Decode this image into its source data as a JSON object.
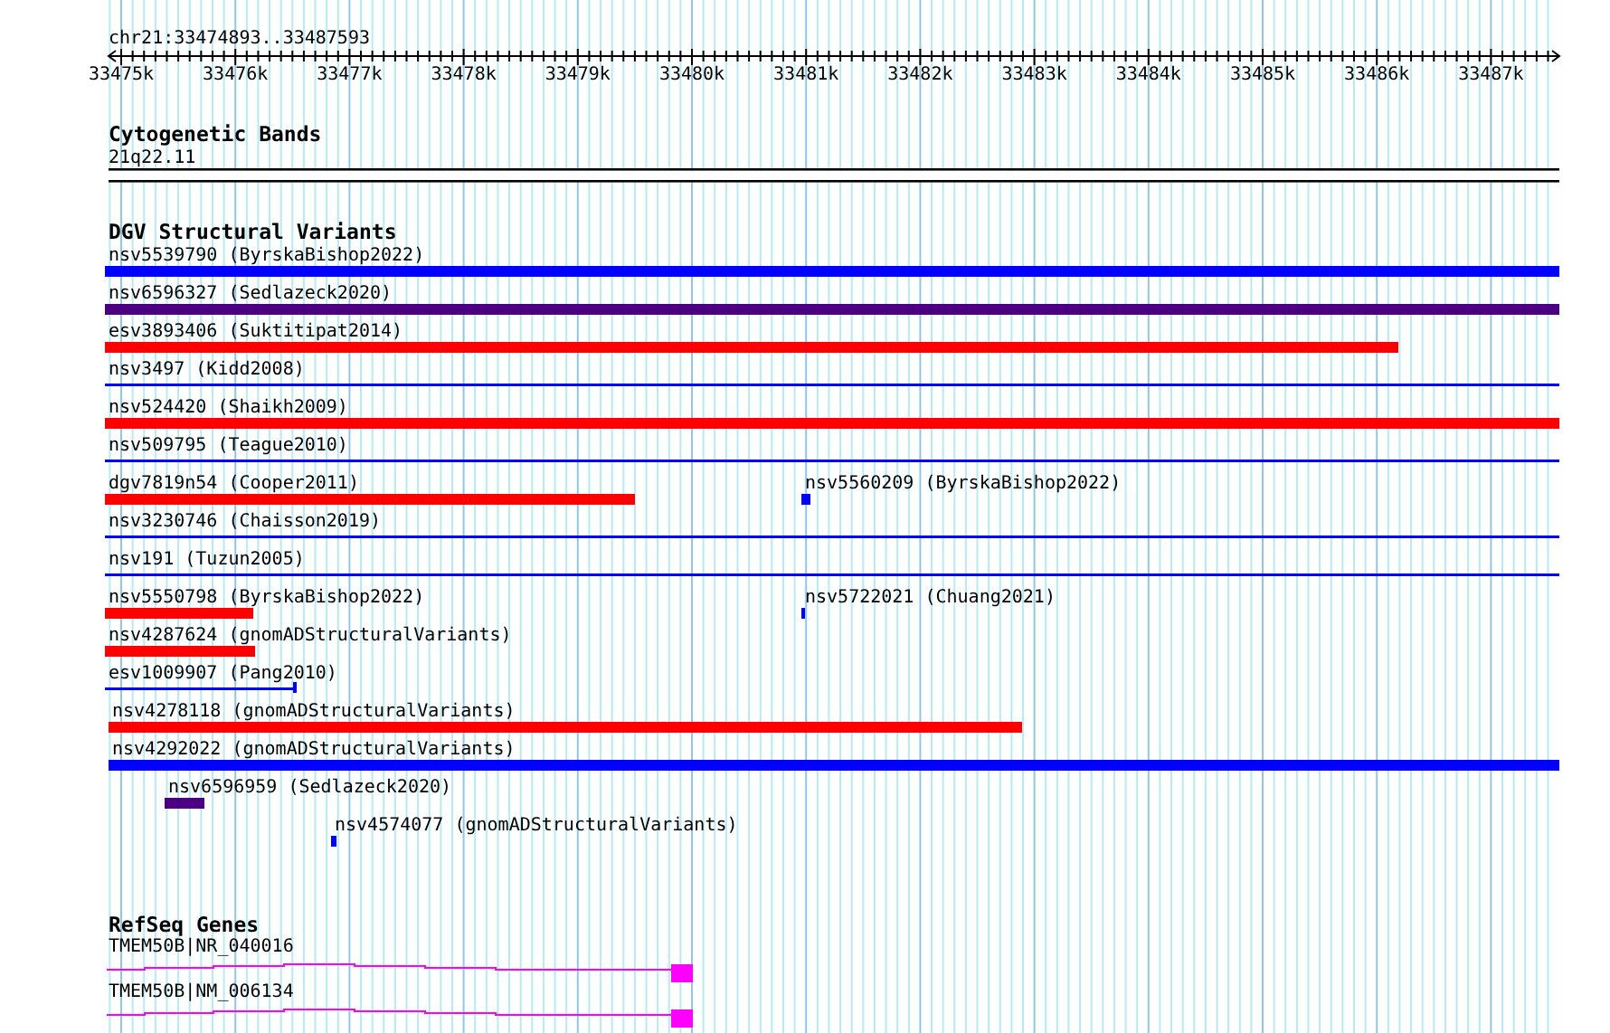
{
  "locus": "chr21:33474893..33487593",
  "ruler": {
    "ticks": [
      "33475k",
      "33476k",
      "33477k",
      "33478k",
      "33479k",
      "33480k",
      "33481k",
      "33482k",
      "33483k",
      "33484k",
      "33485k",
      "33486k",
      "33487k"
    ]
  },
  "tracks": [
    {
      "kind": "bands",
      "title": "Cytogenetic Bands",
      "features": [
        {
          "label": "21q22.11"
        }
      ]
    },
    {
      "kind": "variants",
      "title": "DGV Structural Variants",
      "features": [
        {
          "label": "nsv5539790 (ByrskaBishop2022)",
          "kind": "bar",
          "color": "#0000ff"
        },
        {
          "label": "nsv6596327 (Sedlazeck2020)",
          "kind": "bar",
          "color": "#4b0082"
        },
        {
          "label": "esv3893406 (Suktitipat2014)",
          "kind": "bar",
          "color": "#ff0000"
        },
        {
          "label": "nsv3497 (Kidd2008)",
          "kind": "line",
          "color": "#0000ff"
        },
        {
          "label": "nsv524420 (Shaikh2009)",
          "kind": "bar",
          "color": "#ff0000"
        },
        {
          "label": "nsv509795 (Teague2010)",
          "kind": "line",
          "color": "#0000ff"
        },
        {
          "label": "dgv7819n54 (Cooper2011)",
          "kind": "bar",
          "color": "#ff0000"
        },
        {
          "label": "nsv5560209 (ByrskaBishop2022)",
          "kind": "bar",
          "color": "#0000ff"
        },
        {
          "label": "nsv3230746 (Chaisson2019)",
          "kind": "line",
          "color": "#0000ff"
        },
        {
          "label": "nsv191 (Tuzun2005)",
          "kind": "line",
          "color": "#0000ff"
        },
        {
          "label": "nsv5550798 (ByrskaBishop2022)",
          "kind": "bar",
          "color": "#ff0000"
        },
        {
          "label": "nsv5722021 (Chuang2021)",
          "kind": "bar",
          "color": "#0000ff"
        },
        {
          "label": "nsv4287624 (gnomADStructuralVariants)",
          "kind": "bar",
          "color": "#ff0000"
        },
        {
          "label": "esv1009907 (Pang2010)",
          "kind": "whisker",
          "color": "#0000ff"
        },
        {
          "label": "nsv4278118 (gnomADStructuralVariants)",
          "kind": "bar",
          "color": "#ff0000"
        },
        {
          "label": "nsv4292022 (gnomADStructuralVariants)",
          "kind": "bar",
          "color": "#0000ff"
        },
        {
          "label": "nsv6596959 (Sedlazeck2020)",
          "kind": "bar",
          "color": "#4b0082"
        },
        {
          "label": "nsv4574077 (gnomADStructuralVariants)",
          "kind": "bar",
          "color": "#0000ff"
        }
      ]
    },
    {
      "kind": "genes",
      "title": "RefSeq Genes",
      "features": [
        {
          "label": "TMEM50B|NR_040016"
        },
        {
          "label": "TMEM50B|NM_006134"
        }
      ]
    }
  ]
}
